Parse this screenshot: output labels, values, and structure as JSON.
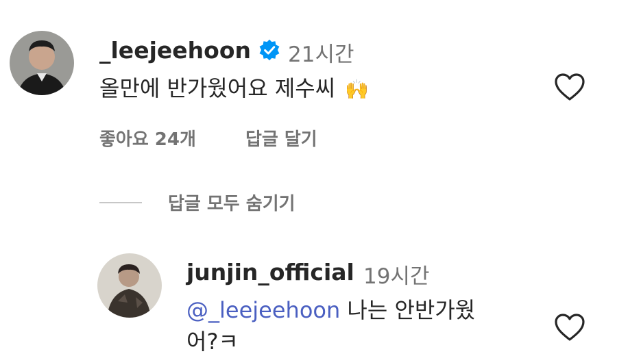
{
  "comment": {
    "username": "_leejeehoon",
    "verified": true,
    "time": "21시간",
    "text": "올만에 반가웠어요 제수씨",
    "emoji": "🙌",
    "likes_label": "좋아요 24개",
    "reply_label": "답글 달기"
  },
  "replies_toggle_label": "답글 모두 숨기기",
  "reply": {
    "username": "junjin_official",
    "time": "19시간",
    "mention": "@_leejeehoon",
    "text_line1": " 나는 안반가웠",
    "text_line2": "어?ㅋ"
  },
  "colors": {
    "verified_blue": "#0095f6",
    "meta_gray": "#737373",
    "mention_blue": "#4a5fc1",
    "emoji_yellow": "#f5b92e"
  }
}
